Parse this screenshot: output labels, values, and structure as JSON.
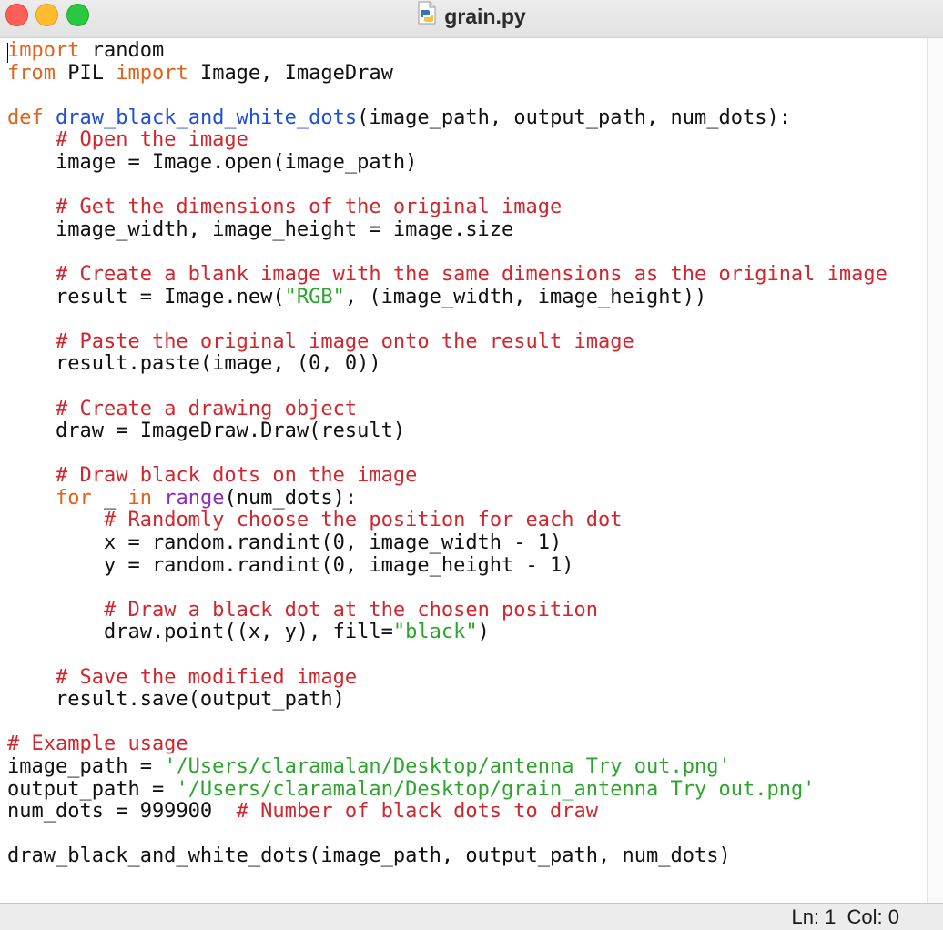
{
  "window": {
    "title": "grain.py",
    "file_icon": "python-file-icon"
  },
  "editor": {
    "lines": [
      [
        {
          "t": "import",
          "c": "kw"
        },
        {
          "t": " random"
        }
      ],
      [
        {
          "t": "from",
          "c": "kw"
        },
        {
          "t": " PIL "
        },
        {
          "t": "import",
          "c": "kw"
        },
        {
          "t": " Image, ImageDraw"
        }
      ],
      [],
      [
        {
          "t": "def",
          "c": "kw"
        },
        {
          "t": " "
        },
        {
          "t": "draw_black_and_white_dots",
          "c": "fn"
        },
        {
          "t": "(image_path, output_path, num_dots):"
        }
      ],
      [
        {
          "t": "    "
        },
        {
          "t": "# Open the image",
          "c": "cm"
        }
      ],
      [
        {
          "t": "    image = Image.open(image_path)"
        }
      ],
      [],
      [
        {
          "t": "    "
        },
        {
          "t": "# Get the dimensions of the original image",
          "c": "cm"
        }
      ],
      [
        {
          "t": "    image_width, image_height = image.size"
        }
      ],
      [],
      [
        {
          "t": "    "
        },
        {
          "t": "# Create a blank image with the same dimensions as the original image",
          "c": "cm"
        }
      ],
      [
        {
          "t": "    result = Image.new("
        },
        {
          "t": "\"RGB\"",
          "c": "st"
        },
        {
          "t": ", (image_width, image_height))"
        }
      ],
      [],
      [
        {
          "t": "    "
        },
        {
          "t": "# Paste the original image onto the result image",
          "c": "cm"
        }
      ],
      [
        {
          "t": "    result.paste(image, (0, 0))"
        }
      ],
      [],
      [
        {
          "t": "    "
        },
        {
          "t": "# Create a drawing object",
          "c": "cm"
        }
      ],
      [
        {
          "t": "    draw = ImageDraw.Draw(result)"
        }
      ],
      [],
      [
        {
          "t": "    "
        },
        {
          "t": "# Draw black dots on the image",
          "c": "cm"
        }
      ],
      [
        {
          "t": "    "
        },
        {
          "t": "for",
          "c": "kw"
        },
        {
          "t": " _ "
        },
        {
          "t": "in",
          "c": "kw"
        },
        {
          "t": " "
        },
        {
          "t": "range",
          "c": "bi"
        },
        {
          "t": "(num_dots):"
        }
      ],
      [
        {
          "t": "        "
        },
        {
          "t": "# Randomly choose the position for each dot",
          "c": "cm"
        }
      ],
      [
        {
          "t": "        x = random.randint(0, image_width - 1)"
        }
      ],
      [
        {
          "t": "        y = random.randint(0, image_height - 1)"
        }
      ],
      [],
      [
        {
          "t": "        "
        },
        {
          "t": "# Draw a black dot at the chosen position",
          "c": "cm"
        }
      ],
      [
        {
          "t": "        draw.point((x, y), fill="
        },
        {
          "t": "\"black\"",
          "c": "st"
        },
        {
          "t": ")"
        }
      ],
      [],
      [
        {
          "t": "    "
        },
        {
          "t": "# Save the modified image",
          "c": "cm"
        }
      ],
      [
        {
          "t": "    result.save(output_path)"
        }
      ],
      [],
      [
        {
          "t": "# Example usage",
          "c": "cm"
        }
      ],
      [
        {
          "t": "image_path = "
        },
        {
          "t": "'/Users/claramalan/Desktop/antenna Try out.png'",
          "c": "st"
        }
      ],
      [
        {
          "t": "output_path = "
        },
        {
          "t": "'/Users/claramalan/Desktop/grain_antenna Try out.png'",
          "c": "st"
        }
      ],
      [
        {
          "t": "num_dots = 999900  "
        },
        {
          "t": "# Number of black dots to draw",
          "c": "cm"
        }
      ],
      [],
      [
        {
          "t": "draw_black_and_white_dots(image_path, output_path, num_dots)"
        }
      ]
    ]
  },
  "status": {
    "line_label": "Ln: 1",
    "col_label": "Col: 0"
  },
  "colors": {
    "keyword": "#e0631a",
    "function": "#1e4fd6",
    "comment": "#d0262d",
    "string": "#2da52d",
    "builtin": "#8a2cc2"
  }
}
